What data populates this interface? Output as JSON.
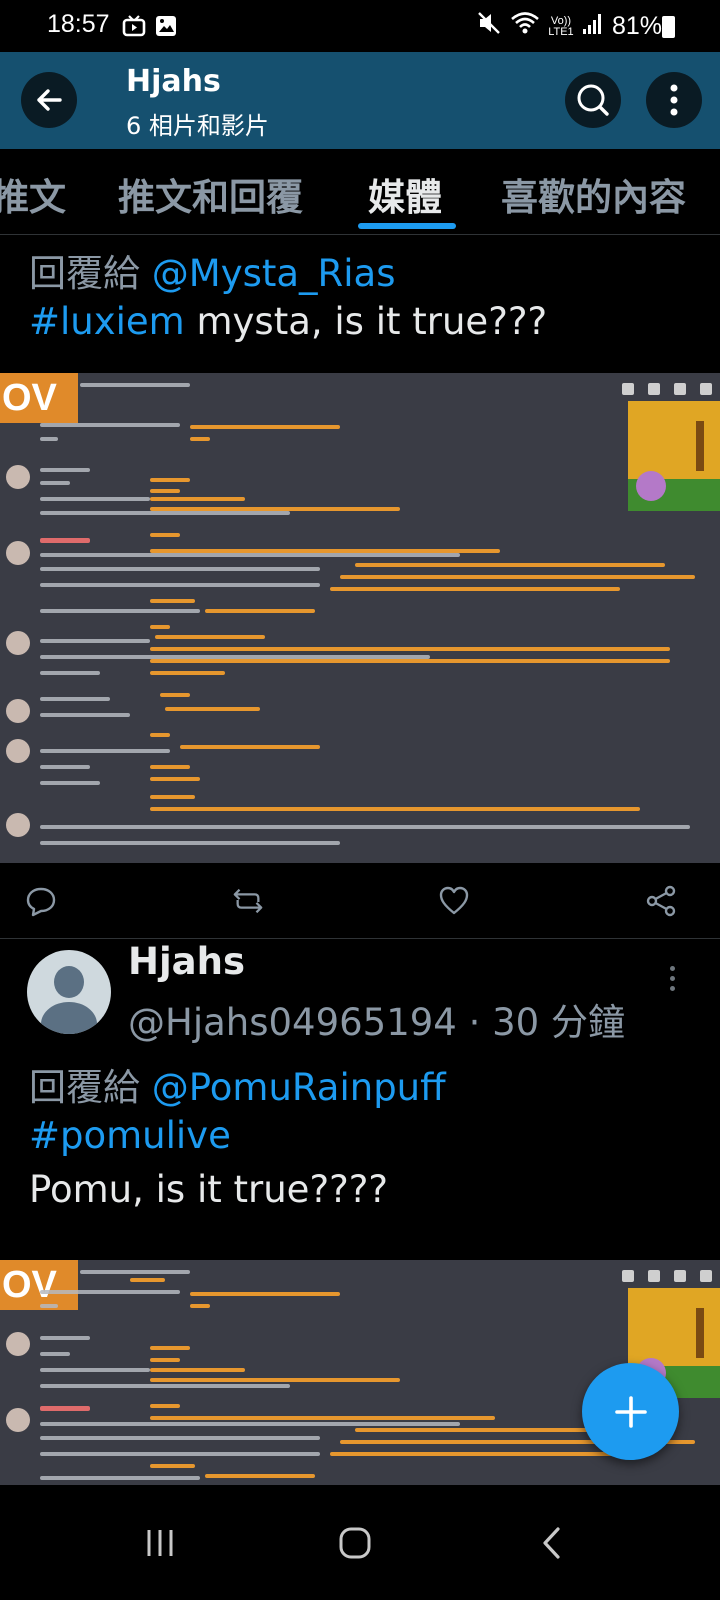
{
  "status_bar": {
    "time": "18:57",
    "volte_label": "Vo)) LTE1",
    "battery": "81%",
    "icons": [
      "tv-icon",
      "gallery-icon",
      "mute-icon",
      "wifi-icon",
      "signal-icon",
      "battery-icon"
    ]
  },
  "header": {
    "title": "Hjahs",
    "subtitle": "6 相片和影片"
  },
  "tabs": [
    {
      "label": "推文"
    },
    {
      "label": "推文和回覆"
    },
    {
      "label": "媒體",
      "active": true
    },
    {
      "label": "喜歡的內容"
    }
  ],
  "tweet1": {
    "reply_prefix": "回覆給",
    "reply_to": "@Mysta_Rias",
    "hashtag": "#luxiem",
    "text": " mysta, is it true???",
    "media_badge": "OV"
  },
  "tweet2": {
    "name": "Hjahs",
    "handle": "@Hjahs04965194",
    "separator": " · ",
    "time": "30 分鐘",
    "reply_prefix": "回覆給",
    "reply_to": "@PomuRainpuff",
    "hashtag": "#pomulive",
    "text": "Pomu, is it true????",
    "media_badge": "OV"
  },
  "colors": {
    "header_bg": "#15506f",
    "accent": "#1d9bf0",
    "muted": "#8b98a5"
  }
}
